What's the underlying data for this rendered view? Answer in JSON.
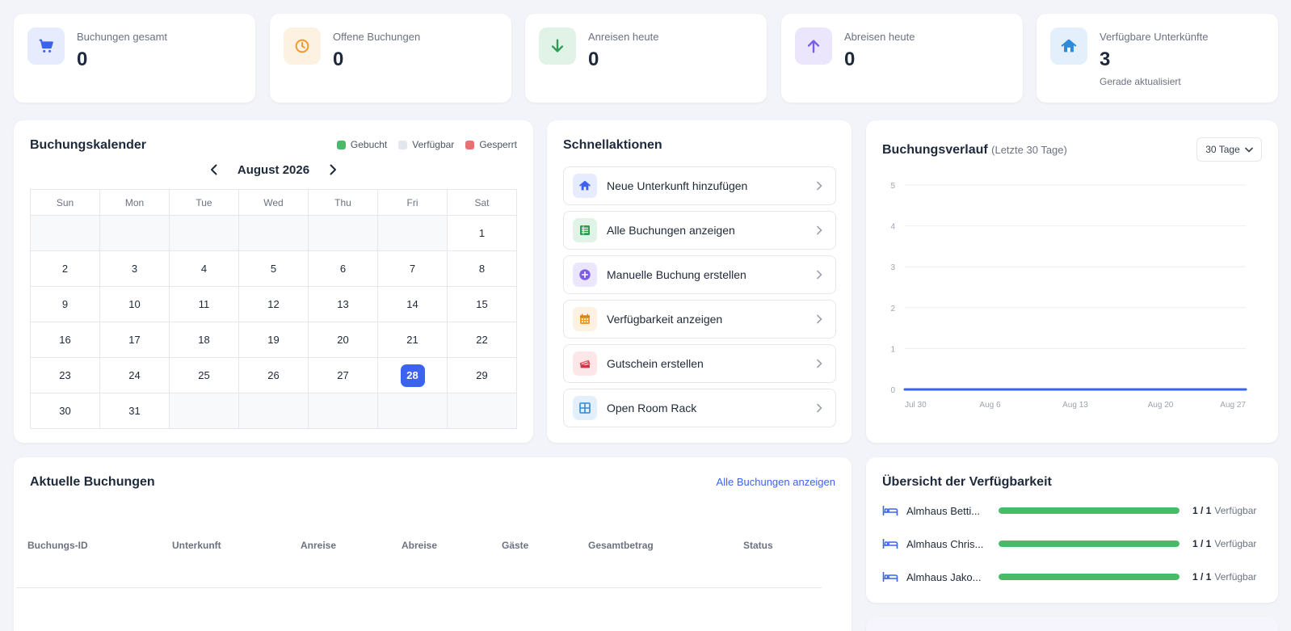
{
  "stats": [
    {
      "label": "Buchungen gesamt",
      "value": "0",
      "icon": "cart-icon",
      "color": "#3b63f0",
      "bg": "#e6ebfd"
    },
    {
      "label": "Offene Buchungen",
      "value": "0",
      "icon": "clock-icon",
      "color": "#f09a2c",
      "bg": "#fdf1e1"
    },
    {
      "label": "Anreisen heute",
      "value": "0",
      "icon": "arrow-down-icon",
      "color": "#2e9c55",
      "bg": "#e1f3e7"
    },
    {
      "label": "Abreisen heute",
      "value": "0",
      "icon": "arrow-up-icon",
      "color": "#7b5bea",
      "bg": "#ece6fd"
    },
    {
      "label": "Verfügbare Unterkünfte",
      "value": "3",
      "sub": "Gerade aktualisiert",
      "icon": "house-icon",
      "color": "#2f8bd8",
      "bg": "#e3effb"
    }
  ],
  "calendar": {
    "title": "Buchungskalender",
    "legend": [
      {
        "label": "Gebucht",
        "color": "#48bb68"
      },
      {
        "label": "Verfügbar",
        "color": "#e2e6ee"
      },
      {
        "label": "Gesperrt",
        "color": "#e57373"
      }
    ],
    "month": "August 2026",
    "weekdays": [
      "Sun",
      "Mon",
      "Tue",
      "Wed",
      "Thu",
      "Fri",
      "Sat"
    ],
    "weeks": [
      [
        "",
        "",
        "",
        "",
        "",
        "",
        "1"
      ],
      [
        "2",
        "3",
        "4",
        "5",
        "6",
        "7",
        "8"
      ],
      [
        "9",
        "10",
        "11",
        "12",
        "13",
        "14",
        "15"
      ],
      [
        "16",
        "17",
        "18",
        "19",
        "20",
        "21",
        "22"
      ],
      [
        "23",
        "24",
        "25",
        "26",
        "27",
        "28",
        "29"
      ],
      [
        "30",
        "31",
        "",
        "",
        "",
        "",
        ""
      ]
    ],
    "today": "28"
  },
  "quick_actions": {
    "title": "Schnellaktionen",
    "items": [
      {
        "label": "Neue Unterkunft hinzufügen",
        "icon": "house-icon",
        "color": "#3b63f0",
        "bg": "#e6ebfd"
      },
      {
        "label": "Alle Buchungen anzeigen",
        "icon": "list-icon",
        "color": "#2e9c55",
        "bg": "#e1f3e7"
      },
      {
        "label": "Manuelle Buchung erstellen",
        "icon": "plus-circle-icon",
        "color": "#7b5bea",
        "bg": "#ece6fd"
      },
      {
        "label": "Verfügbarkeit anzeigen",
        "icon": "calendar-icon",
        "color": "#f09a2c",
        "bg": "#fdf1e1"
      },
      {
        "label": "Gutschein erstellen",
        "icon": "ticket-icon",
        "color": "#e04c5a",
        "bg": "#fde6e8"
      },
      {
        "label": "Open Room Rack",
        "icon": "grid-icon",
        "color": "#2f8bd8",
        "bg": "#e3effb"
      }
    ]
  },
  "booking_chart": {
    "title": "Buchungsverlauf",
    "subtitle": "(Letzte 30 Tage)",
    "range_select": "30 Tage"
  },
  "chart_data": {
    "type": "line",
    "x": [
      "Jul 30",
      "Aug 6",
      "Aug 13",
      "Aug 20",
      "Aug 27"
    ],
    "series": [
      {
        "values": [
          0,
          0,
          0,
          0,
          0
        ],
        "color": "#3b63f0"
      }
    ],
    "xticks": [
      "Jul 30",
      "Aug 6",
      "Aug 13",
      "Aug 20",
      "Aug 27"
    ],
    "yticks": [
      "0",
      "1",
      "2",
      "3",
      "4",
      "5"
    ],
    "ylim": [
      0,
      5
    ],
    "grid": true,
    "xlabel": "",
    "ylabel": ""
  },
  "bookings": {
    "title": "Aktuelle Buchungen",
    "link": "Alle Buchungen anzeigen",
    "columns": [
      "Buchungs-ID",
      "Unterkunft",
      "Anreise",
      "Abreise",
      "Gäste",
      "Gesamtbetrag",
      "Status"
    ]
  },
  "availability": {
    "title": "Übersicht der Verfügbarkeit",
    "items": [
      {
        "name": "Almhaus Betti...",
        "count": "1 / 1",
        "status": "Verfügbar",
        "ratio": 1
      },
      {
        "name": "Almhaus Chris...",
        "count": "1 / 1",
        "status": "Verfügbar",
        "ratio": 1
      },
      {
        "name": "Almhaus Jako...",
        "count": "1 / 1",
        "status": "Verfügbar",
        "ratio": 1
      }
    ]
  }
}
